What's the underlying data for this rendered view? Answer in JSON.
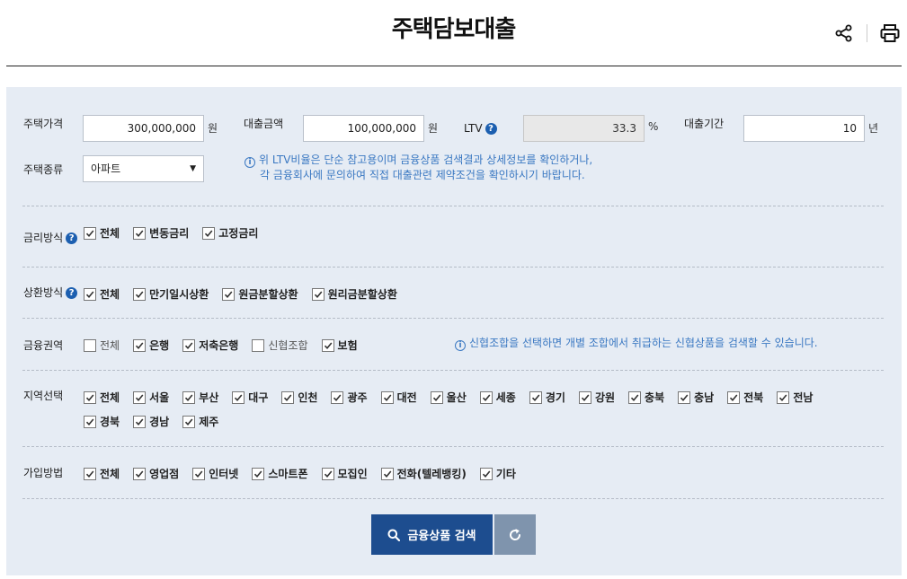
{
  "header": {
    "title": "주택담보대출",
    "share_icon": "share-icon",
    "print_icon": "print-icon"
  },
  "form": {
    "house_price": {
      "label": "주택가격",
      "value": "300,000,000",
      "unit": "원"
    },
    "loan_amount": {
      "label": "대출금액",
      "value": "100,000,000",
      "unit": "원"
    },
    "ltv": {
      "label": "LTV",
      "value": "33.3",
      "unit": "%"
    },
    "loan_period": {
      "label": "대출기간",
      "value": "10",
      "unit": "년"
    },
    "house_type": {
      "label": "주택종류",
      "selected": "아파트"
    },
    "ltv_notice_line1": "위 LTV비율은 단순 참고용이며 금융상품 검색결과 상세정보를 확인하거나,",
    "ltv_notice_line2": "각 금융회사에 문의하여 직접 대출관련 제약조건을 확인하시기 바랍니다."
  },
  "rate_type": {
    "label": "금리방식",
    "options": [
      {
        "label": "전체",
        "checked": true
      },
      {
        "label": "변동금리",
        "checked": true
      },
      {
        "label": "고정금리",
        "checked": true
      }
    ]
  },
  "repay_type": {
    "label": "상환방식",
    "options": [
      {
        "label": "전체",
        "checked": true
      },
      {
        "label": "만기일시상환",
        "checked": true
      },
      {
        "label": "원금분할상환",
        "checked": true
      },
      {
        "label": "원리금분할상환",
        "checked": true
      }
    ]
  },
  "finance_sector": {
    "label": "금융권역",
    "options": [
      {
        "label": "전체",
        "checked": false
      },
      {
        "label": "은행",
        "checked": true
      },
      {
        "label": "저축은행",
        "checked": true
      },
      {
        "label": "신협조합",
        "checked": false
      },
      {
        "label": "보험",
        "checked": true
      }
    ],
    "notice": "신협조합을 선택하면 개별 조합에서 취급하는 신협상품을 검색할 수 있습니다."
  },
  "region": {
    "label": "지역선택",
    "row1": [
      {
        "label": "전체",
        "checked": true
      },
      {
        "label": "서울",
        "checked": true
      },
      {
        "label": "부산",
        "checked": true
      },
      {
        "label": "대구",
        "checked": true
      },
      {
        "label": "인천",
        "checked": true
      },
      {
        "label": "광주",
        "checked": true
      },
      {
        "label": "대전",
        "checked": true
      },
      {
        "label": "울산",
        "checked": true
      },
      {
        "label": "세종",
        "checked": true
      },
      {
        "label": "경기",
        "checked": true
      },
      {
        "label": "강원",
        "checked": true
      },
      {
        "label": "충북",
        "checked": true
      },
      {
        "label": "충남",
        "checked": true
      },
      {
        "label": "전북",
        "checked": true
      },
      {
        "label": "전남",
        "checked": true
      }
    ],
    "row2": [
      {
        "label": "경북",
        "checked": true
      },
      {
        "label": "경남",
        "checked": true
      },
      {
        "label": "제주",
        "checked": true
      }
    ]
  },
  "join_method": {
    "label": "가입방법",
    "options": [
      {
        "label": "전체",
        "checked": true
      },
      {
        "label": "영업점",
        "checked": true
      },
      {
        "label": "인터넷",
        "checked": true
      },
      {
        "label": "스마트폰",
        "checked": true
      },
      {
        "label": "모집인",
        "checked": true
      },
      {
        "label": "전화(텔레뱅킹)",
        "checked": true
      },
      {
        "label": "기타",
        "checked": true
      }
    ]
  },
  "actions": {
    "search_label": "금융상품 검색",
    "search_icon": "search-icon",
    "reset_icon": "reset-icon"
  },
  "colors": {
    "panel_bg": "#e6ecf4",
    "primary": "#1d4d8f",
    "reset_bg": "#7f94ad",
    "notice": "#3a78c2"
  }
}
